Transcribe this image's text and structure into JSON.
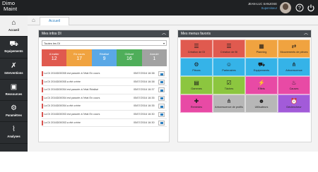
{
  "header": {
    "logo_line1": "Dimo",
    "logo_line2": "Maint",
    "user_name": "JEAN-LUC SANJOSE",
    "user_role": "Superviseur",
    "icons": [
      "avatar",
      "help-icon",
      "power-icon"
    ]
  },
  "sidebar": {
    "items": [
      {
        "label": "Accueil",
        "icon": "home-icon",
        "glyph": "⌂",
        "active": true
      },
      {
        "label": "Equipements",
        "icon": "truck-icon",
        "glyph": "⛟",
        "active": false
      },
      {
        "label": "Interventions",
        "icon": "wrench-icon",
        "glyph": "✗",
        "active": false
      },
      {
        "label": "Ressources",
        "icon": "briefcase-icon",
        "glyph": "▣",
        "active": false
      },
      {
        "label": "Paramètres",
        "icon": "settings-icon",
        "glyph": "⚙",
        "active": false
      },
      {
        "label": "Analyses",
        "icon": "chart-icon",
        "glyph": "⌇",
        "active": false
      }
    ]
  },
  "tabs": {
    "home_glyph": "⌂",
    "active_label": "Accueil"
  },
  "infos": {
    "title": "Mes infos DI",
    "collapse_glyph": "︿",
    "filter_value": "Toutes les DI",
    "filter_arrow": "▾",
    "stats": [
      {
        "label": "A traiter",
        "value": "12",
        "color": "#e05a4f"
      },
      {
        "label": "En cours",
        "value": "17",
        "color": "#f0a340"
      },
      {
        "label": "Réalisé",
        "value": "9",
        "color": "#5aa8e6"
      },
      {
        "label": "Clôturé",
        "value": "16",
        "color": "#4fae5a"
      },
      {
        "label": "Annulé",
        "value": "1",
        "color": "#a2a2a2"
      }
    ],
    "rows": [
      {
        "text": "La DI 2016D00055 est passée à l'état En cours",
        "date": "05/07/2016 16:38"
      },
      {
        "text": "La DI 2016D00055 a été créée",
        "date": "05/07/2016 16:38"
      },
      {
        "text": "La DI 2016D00054 est passée à l'état Réalisé",
        "date": "05/07/2016 16:37"
      },
      {
        "text": "La DI 2016D00054 est passée à l'état En cours",
        "date": "05/07/2016 16:35"
      },
      {
        "text": "La DI 2016D00054 a été créée",
        "date": "05/07/2016 16:35"
      },
      {
        "text": "La DI 2016D00053 est passée à l'état En cours",
        "date": "05/07/2016 16:30"
      },
      {
        "text": "La DI 2016D00053 a été créée",
        "date": "05/07/2016 16:30"
      }
    ]
  },
  "favoris": {
    "title": "Mes menus favoris",
    "collapse_glyph": "︿",
    "tiles": [
      {
        "label": "Création de DI",
        "icon": "checklist-icon",
        "glyph": "☰",
        "color": "#e05a4f"
      },
      {
        "label": "Création de BI",
        "icon": "checklist-icon",
        "glyph": "☰",
        "color": "#e05a4f"
      },
      {
        "label": "Planning",
        "icon": "calendar-icon",
        "glyph": "▦",
        "color": "#f0a340"
      },
      {
        "label": "Mouvements de pièces",
        "icon": "transfer-icon",
        "glyph": "⇄",
        "color": "#f0a340"
      },
      {
        "label": "Pièces",
        "icon": "gear-icon",
        "glyph": "⚙",
        "color": "#35b3e8"
      },
      {
        "label": "Partenaires",
        "icon": "people-icon",
        "glyph": "☺",
        "color": "#35b3e8"
      },
      {
        "label": "Equipements",
        "icon": "truck-icon",
        "glyph": "⛟",
        "color": "#35b3e8"
      },
      {
        "label": "Arborescence",
        "icon": "tree-icon",
        "glyph": "⋔",
        "color": "#35b3e8"
      },
      {
        "label": "Gammes",
        "icon": "layers-icon",
        "glyph": "▤",
        "color": "#8cc63f"
      },
      {
        "label": "Tâches",
        "icon": "task-icon",
        "glyph": "☑",
        "color": "#8cc63f"
      },
      {
        "label": "Effets",
        "icon": "flash-icon",
        "glyph": "⚡",
        "color": "#e84aa5"
      },
      {
        "label": "Causes",
        "icon": "flame-icon",
        "glyph": "♨",
        "color": "#e84aa5"
      },
      {
        "label": "Remèdes",
        "icon": "medkit-icon",
        "glyph": "✚",
        "color": "#e84aa5"
      },
      {
        "label": "Arborescence de profils",
        "icon": "tree-icon",
        "glyph": "⋔",
        "color": "#b7b7b7"
      },
      {
        "label": "Utilisateurs",
        "icon": "user-icon",
        "glyph": "☻",
        "color": "#b7b7b7"
      },
      {
        "label": "Déclencheur",
        "icon": "alarm-icon",
        "glyph": "⏰",
        "color": "#a25bd9"
      }
    ]
  }
}
